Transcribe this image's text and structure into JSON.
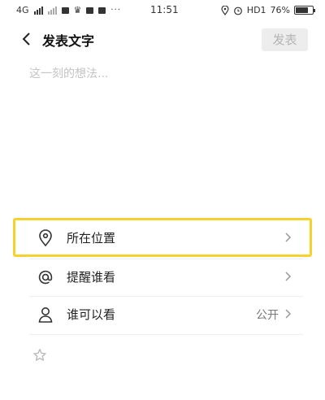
{
  "status_bar": {
    "network": "4G",
    "time": "11:51",
    "signal_label": "HD",
    "signal_sub": "1",
    "battery_percent": "76%",
    "battery_level": 0.76,
    "dots": "···"
  },
  "header": {
    "title": "发表文字",
    "publish_label": "发表"
  },
  "compose": {
    "placeholder": "这一刻的想法..."
  },
  "options": [
    {
      "label": "所在位置",
      "value": "",
      "icon": "location-pin-icon",
      "highlighted": true
    },
    {
      "label": "提醒谁看",
      "value": "",
      "icon": "at-sign-icon"
    },
    {
      "label": "谁可以看",
      "value": "公开",
      "icon": "person-icon"
    }
  ],
  "colors": {
    "highlight": "#f5d22e",
    "publish_bg": "#ededed",
    "publish_text": "#b5b5b5",
    "placeholder": "#c4c4c4"
  }
}
